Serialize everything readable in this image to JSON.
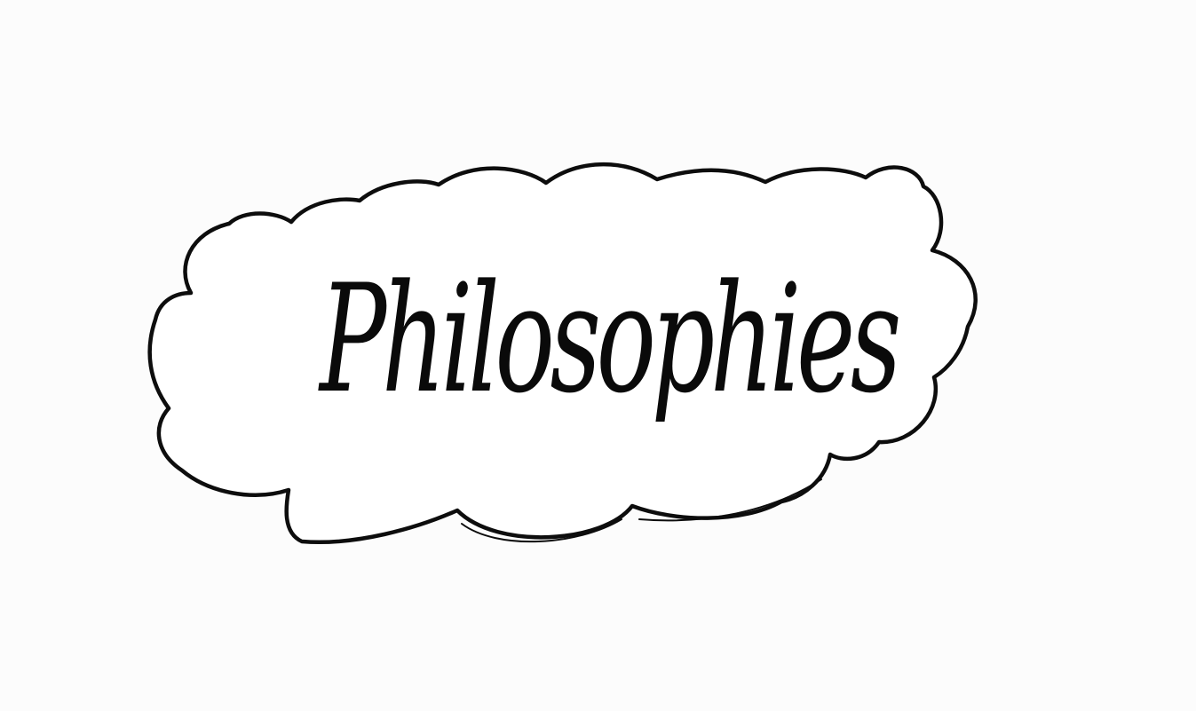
{
  "drawing": {
    "word": "Philosophies",
    "ink_color": "#0a0a0a",
    "paper_color": "#fcfcfc"
  }
}
